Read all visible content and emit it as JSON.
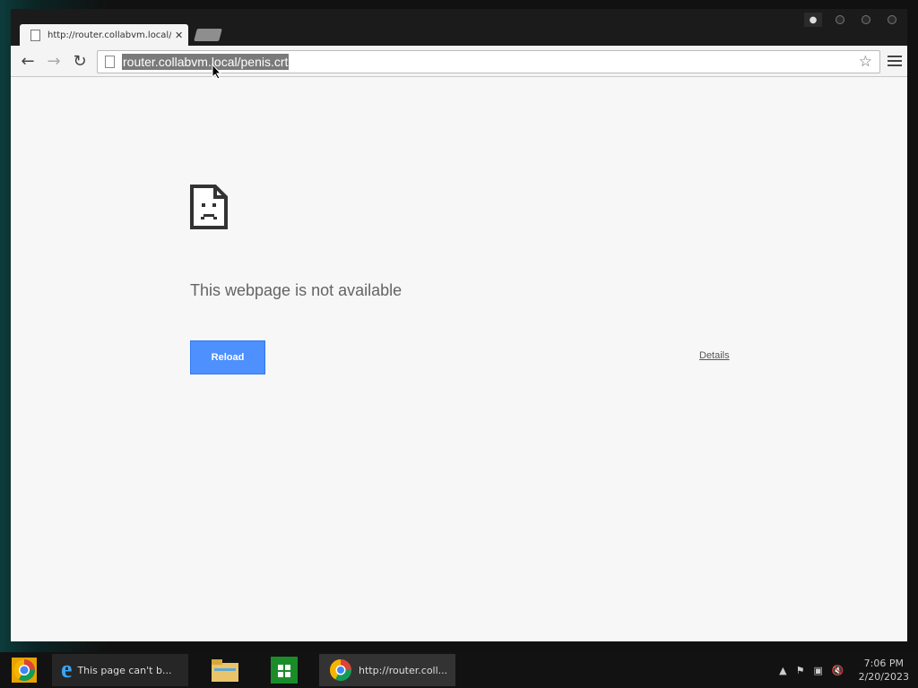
{
  "browser": {
    "tab_title": "http://router.collabvm.local/pe",
    "address": "router.collabvm.local/penis.crt"
  },
  "error_page": {
    "title": "This webpage is not available",
    "reload_label": "Reload",
    "details_label": "Details"
  },
  "taskbar": {
    "ie_label": "This page can't b...",
    "chrome_label": "http://router.coll...",
    "time": "7:06 PM",
    "date": "2/20/2023"
  },
  "colors": {
    "reload_button": "#4d90fe",
    "selection": "#7a7a7a",
    "page_background": "#f7f7f7"
  },
  "icons": [
    "page-icon",
    "close-icon",
    "back-icon",
    "forward-icon",
    "reload-icon",
    "star-icon",
    "menu-icon",
    "sad-page-icon",
    "chrome-icon",
    "ie-icon",
    "folder-icon",
    "store-icon",
    "flag-icon",
    "network-icon",
    "speaker-muted-icon",
    "tray-arrow-icon",
    "user-icon"
  ]
}
